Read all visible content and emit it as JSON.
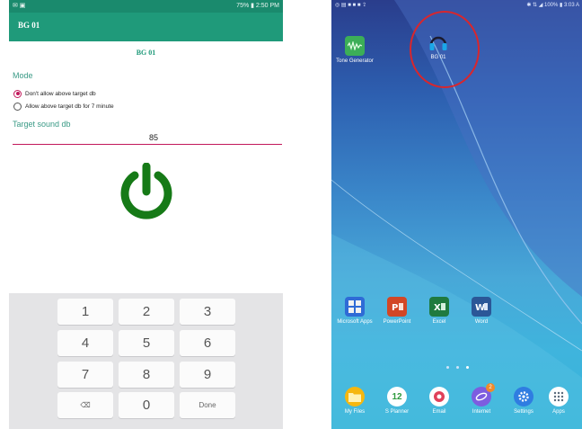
{
  "left_phone": {
    "status_bar": {
      "left_icons": "✉ ▣",
      "time": "75% ▮ 2:50 PM"
    },
    "app_bar": {
      "title": "BG 01"
    },
    "content_title": "BG 01",
    "mode": {
      "label": "Mode",
      "options": [
        {
          "label": "Don't allow above target db",
          "selected": true
        },
        {
          "label": "Allow above target db for  7 minute",
          "selected": false
        }
      ]
    },
    "target": {
      "label": "Target sound db",
      "value": "85"
    },
    "power_button": {
      "icon": "power-icon",
      "color": "#167a17"
    },
    "keypad": {
      "keys": [
        "1",
        "2",
        "3",
        "4",
        "5",
        "6",
        "7",
        "8",
        "9",
        "⌫",
        "0",
        "Done"
      ]
    },
    "colors": {
      "primary": "#1f9a7a",
      "accent": "#c2185b"
    }
  },
  "right_phone": {
    "status_bar": {
      "left_icons": "◎ ▤ ■ ■ ■ ⇪",
      "right": "✱ ⇅ ◢ 100% ▮ 3:03 A"
    },
    "top_apps": [
      {
        "name": "Tone Generator",
        "icon": "waveform-icon"
      },
      {
        "name": "BG 01",
        "icon": "headphones-icon"
      }
    ],
    "middle_apps": [
      {
        "name": "Microsoft Apps",
        "icon": "microsoft-apps-icon"
      },
      {
        "name": "PowerPoint",
        "icon": "powerpoint-icon"
      },
      {
        "name": "Excel",
        "icon": "excel-icon"
      },
      {
        "name": "Word",
        "icon": "word-icon"
      }
    ],
    "dock_apps": [
      {
        "name": "My Files",
        "icon": "folder-icon"
      },
      {
        "name": "S Planner",
        "icon": "calendar-icon",
        "value": "12"
      },
      {
        "name": "Email",
        "icon": "email-icon"
      },
      {
        "name": "Internet",
        "icon": "internet-icon",
        "badge": "2"
      },
      {
        "name": "Settings",
        "icon": "gear-icon"
      },
      {
        "name": "Apps",
        "icon": "apps-grid-icon"
      }
    ],
    "highlight_color": "#d9262c"
  }
}
